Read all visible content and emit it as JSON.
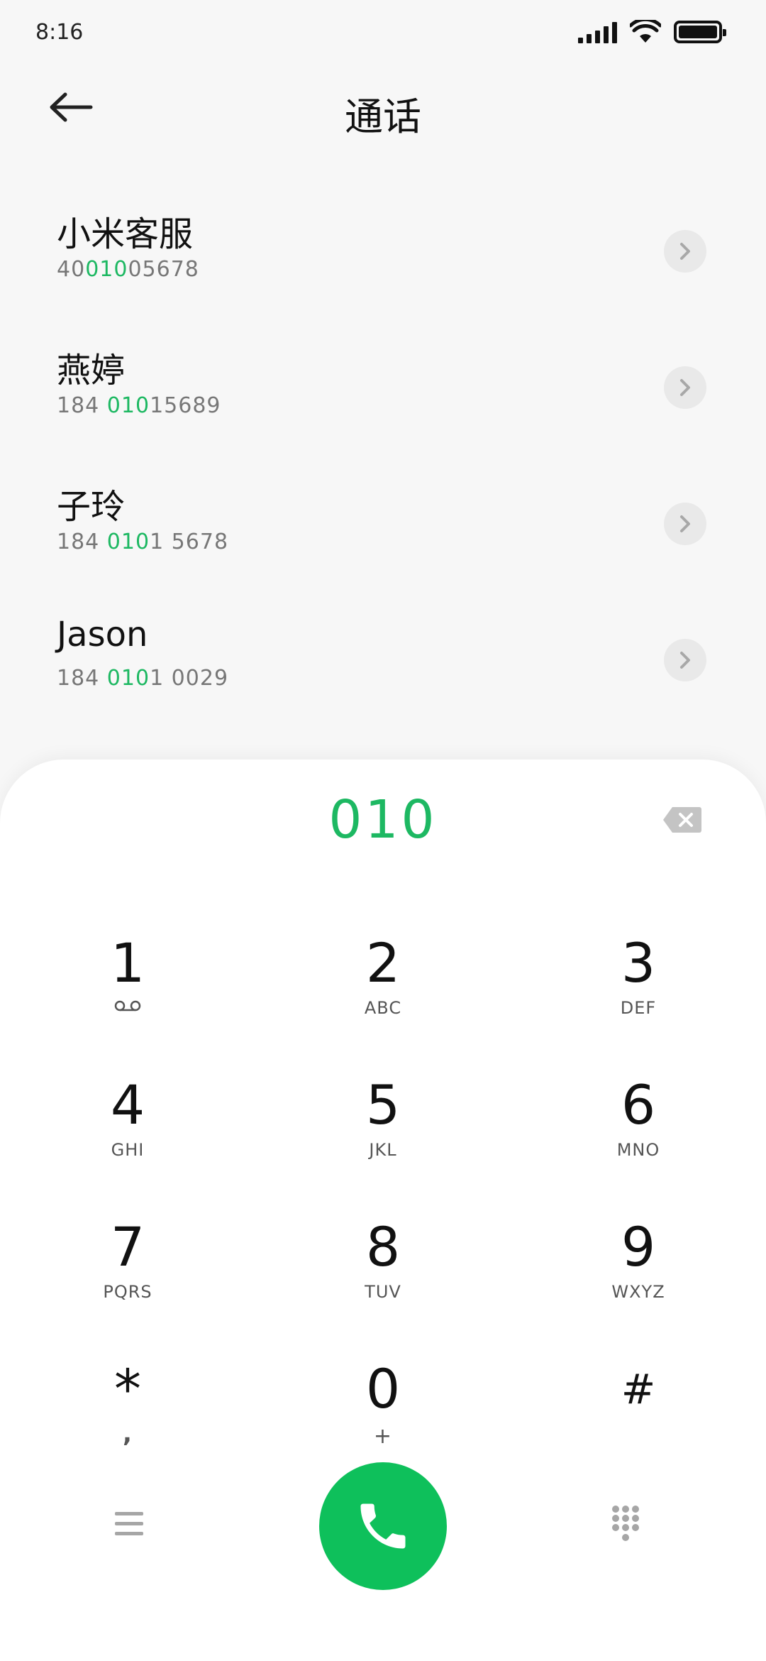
{
  "status_bar": {
    "time": "8:16",
    "icons": [
      "signal-icon",
      "wifi-icon",
      "battery-icon"
    ]
  },
  "header": {
    "title": "通话",
    "back_icon": "arrow-left-icon"
  },
  "contacts": [
    {
      "name": "小米客服",
      "number_prefix": "40",
      "number_match": "010",
      "number_suffix": "05678"
    },
    {
      "name": "燕婷",
      "number_prefix": "184 ",
      "number_match": "010",
      "number_suffix": "15689"
    },
    {
      "name": "子玲",
      "number_prefix": "184 ",
      "number_match": "010",
      "number_suffix": "1 5678"
    },
    {
      "name": "Jason",
      "number_prefix": "184 ",
      "number_match": "010",
      "number_suffix": "1 0029"
    }
  ],
  "dialer": {
    "input": "010",
    "backspace_icon": "backspace-icon",
    "keys": [
      {
        "digit": "1",
        "letters": ""
      },
      {
        "digit": "2",
        "letters": "ABC"
      },
      {
        "digit": "3",
        "letters": "DEF"
      },
      {
        "digit": "4",
        "letters": "GHI"
      },
      {
        "digit": "5",
        "letters": "JKL"
      },
      {
        "digit": "6",
        "letters": "MNO"
      },
      {
        "digit": "7",
        "letters": "PQRS"
      },
      {
        "digit": "8",
        "letters": "TUV"
      },
      {
        "digit": "9",
        "letters": "WXYZ"
      },
      {
        "digit": "*",
        "letters": ","
      },
      {
        "digit": "0",
        "letters": "+"
      },
      {
        "digit": "#",
        "letters": ""
      }
    ]
  },
  "bottom_bar": {
    "menu_icon": "menu-icon",
    "call_icon": "phone-icon",
    "keypad_icon": "dialpad-icon"
  },
  "colors": {
    "accent": "#1db862",
    "call_button": "#0ec05b",
    "background": "#f7f7f7"
  }
}
